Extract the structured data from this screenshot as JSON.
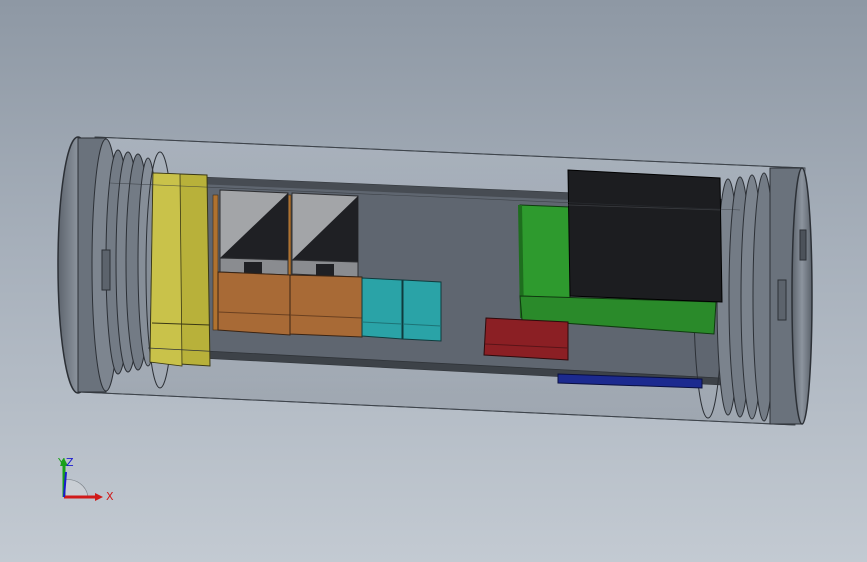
{
  "window": {
    "kind": "3d-cad-viewport"
  },
  "colors": {
    "background_top": "#8e98a4",
    "background_bottom": "#c3cad2",
    "housing": "#7c8592",
    "endcap": "#6e7680",
    "pcb_board": "#5f6670",
    "yellow_block": "#b8b13a",
    "orange_block": "#a86a36",
    "transformer_gray": "#a3a5a8",
    "cyan_block": "#2aa3a7",
    "green_board": "#2a8a2a",
    "black_block": "#1c1d20",
    "red_block": "#8b1f24",
    "blue_strip": "#1c2a8f",
    "axis_x": "#d01a1a",
    "axis_y": "#1aa01a",
    "axis_z": "#1a1ad0"
  },
  "triad": {
    "x_label": "X",
    "y_label": "Y",
    "z_label": "Z"
  },
  "parts": [
    {
      "name": "left-endcap",
      "icon": "cylinder-cap-icon"
    },
    {
      "name": "right-endcap",
      "icon": "cylinder-cap-icon"
    },
    {
      "name": "transparent-housing",
      "icon": "tube-icon"
    },
    {
      "name": "yellow-component",
      "icon": "box-icon"
    },
    {
      "name": "transformer-1",
      "icon": "box-icon"
    },
    {
      "name": "transformer-2",
      "icon": "box-icon"
    },
    {
      "name": "cyan-capacitor-1",
      "icon": "box-icon"
    },
    {
      "name": "cyan-capacitor-2",
      "icon": "box-icon"
    },
    {
      "name": "green-board",
      "icon": "box-icon"
    },
    {
      "name": "black-module",
      "icon": "box-icon"
    },
    {
      "name": "red-component",
      "icon": "box-icon"
    },
    {
      "name": "blue-strip",
      "icon": "box-icon"
    }
  ]
}
